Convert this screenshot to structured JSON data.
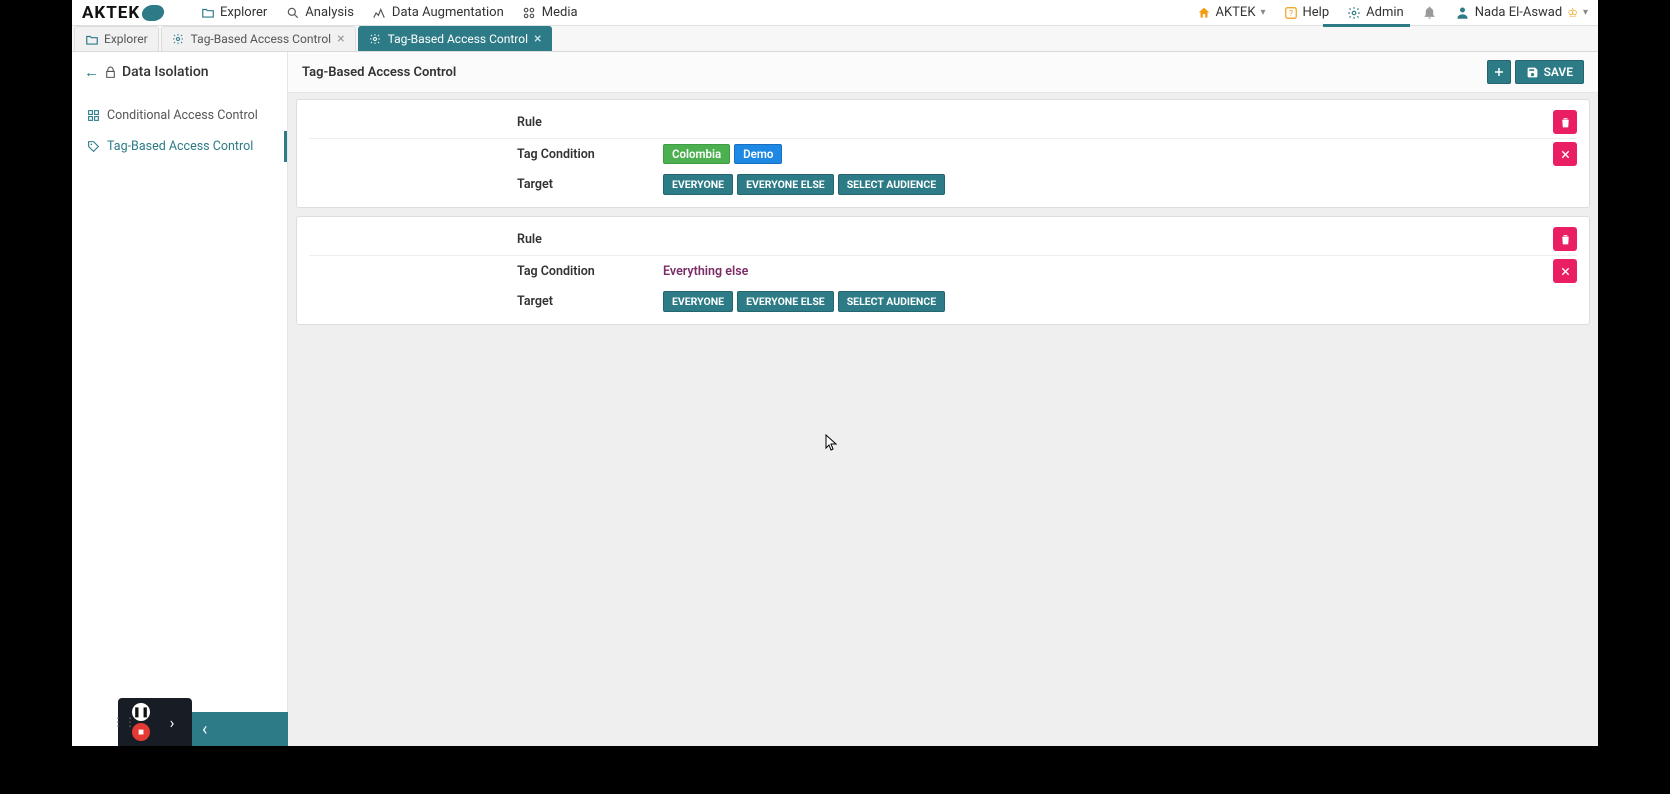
{
  "logo": {
    "text": "AKTEK"
  },
  "top_nav": [
    {
      "icon": "folder",
      "label": "Explorer"
    },
    {
      "icon": "search",
      "label": "Analysis"
    },
    {
      "icon": "spark",
      "label": "Data Augmentation"
    },
    {
      "icon": "media",
      "label": "Media"
    }
  ],
  "top_right": {
    "company": {
      "icon": "home",
      "label": "AKTEK"
    },
    "help": {
      "icon": "help",
      "label": "Help"
    },
    "admin": {
      "icon": "gear",
      "label": "Admin"
    },
    "user": {
      "icon": "person",
      "label": "Nada El-Aswad"
    }
  },
  "tabs": [
    {
      "icon": "folder",
      "label": "Explorer",
      "active": false,
      "closable": false
    },
    {
      "icon": "gear",
      "label": "Tag-Based Access Control",
      "active": false,
      "closable": true
    },
    {
      "icon": "gear",
      "label": "Tag-Based Access Control",
      "active": true,
      "closable": true
    }
  ],
  "sidebar": {
    "title": "Data Isolation",
    "items": [
      {
        "icon": "grid",
        "label": "Conditional Access Control",
        "selected": false
      },
      {
        "icon": "tag",
        "label": "Tag-Based Access Control",
        "selected": true
      }
    ]
  },
  "page": {
    "title": "Tag-Based Access Control",
    "save_label": "SAVE",
    "row_labels": {
      "rule": "Rule",
      "tag": "Tag Condition",
      "target": "Target"
    },
    "target_buttons": [
      "EVERYONE",
      "EVERYONE ELSE",
      "SELECT AUDIENCE"
    ],
    "rules": [
      {
        "tag_type": "chips",
        "tags": [
          {
            "label": "Colombia",
            "color": "green"
          },
          {
            "label": "Demo",
            "color": "blue"
          }
        ]
      },
      {
        "tag_type": "text",
        "text": "Everything else"
      }
    ]
  }
}
